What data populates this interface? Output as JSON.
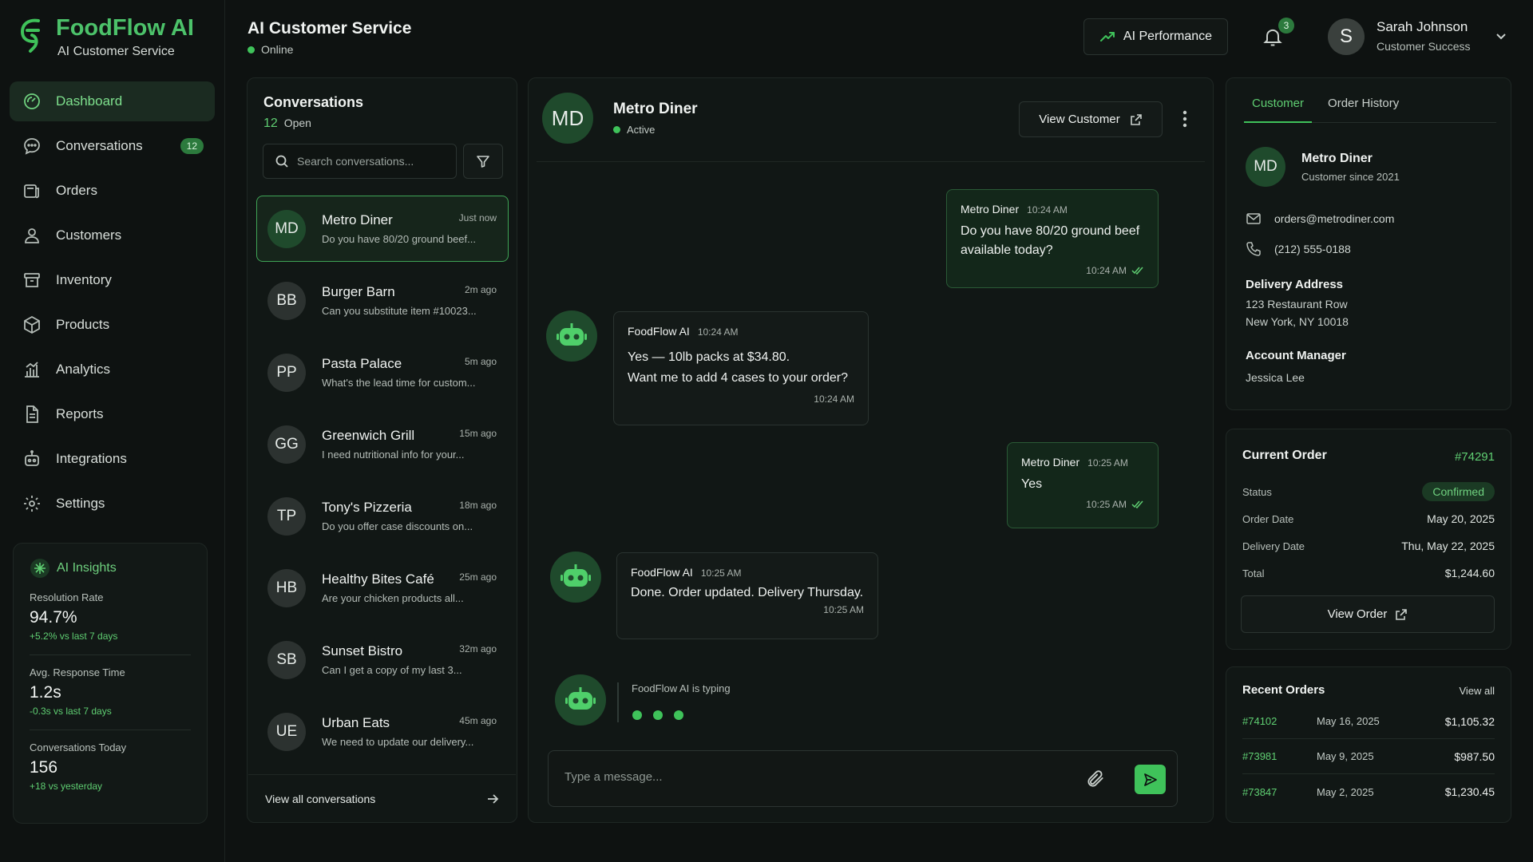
{
  "brand": {
    "title": "FoodFlow AI",
    "subtitle": "AI Customer Service"
  },
  "nav": [
    {
      "label": "Dashboard",
      "icon": "dashboard-icon",
      "active": true
    },
    {
      "label": "Conversations",
      "icon": "chat-icon",
      "badge": "12"
    },
    {
      "label": "Orders",
      "icon": "orders-icon"
    },
    {
      "label": "Customers",
      "icon": "customers-icon"
    },
    {
      "label": "Inventory",
      "icon": "inventory-icon"
    },
    {
      "label": "Products",
      "icon": "products-icon"
    },
    {
      "label": "Analytics",
      "icon": "analytics-icon"
    },
    {
      "label": "Reports",
      "icon": "reports-icon"
    },
    {
      "label": "Integrations",
      "icon": "integrations-icon"
    },
    {
      "label": "Settings",
      "icon": "settings-icon"
    }
  ],
  "insights": {
    "title": "AI Insights",
    "metrics": [
      {
        "label": "Resolution Rate",
        "value": "94.7%",
        "delta": "+5.2% vs last 7 days"
      },
      {
        "label": "Avg. Response Time",
        "value": "1.2s",
        "delta": "-0.3s vs last 7 days"
      },
      {
        "label": "Conversations Today",
        "value": "156",
        "delta": "+18 vs yesterday"
      }
    ]
  },
  "header": {
    "title": "AI Customer Service",
    "status": "Online",
    "perf_label": "AI Performance",
    "notif_count": "3",
    "user": {
      "initial": "S",
      "name": "Sarah Johnson",
      "role": "Customer Success"
    }
  },
  "conversations": {
    "title": "Conversations",
    "open_count": "12",
    "open_label": "Open",
    "search_placeholder": "Search conversations...",
    "items": [
      {
        "initials": "MD",
        "name": "Metro Diner",
        "time": "Just now",
        "preview": "Do you have 80/20 ground beef...",
        "active": true
      },
      {
        "initials": "BB",
        "name": "Burger Barn",
        "time": "2m ago",
        "preview": "Can you substitute item #10023..."
      },
      {
        "initials": "PP",
        "name": "Pasta Palace",
        "time": "5m ago",
        "preview": "What's the lead time for custom..."
      },
      {
        "initials": "GG",
        "name": "Greenwich Grill",
        "time": "15m ago",
        "preview": "I need nutritional info for your..."
      },
      {
        "initials": "TP",
        "name": "Tony's Pizzeria",
        "time": "18m ago",
        "preview": "Do you offer case discounts on..."
      },
      {
        "initials": "HB",
        "name": "Healthy Bites Café",
        "time": "25m ago",
        "preview": "Are your chicken products all..."
      },
      {
        "initials": "SB",
        "name": "Sunset Bistro",
        "time": "32m ago",
        "preview": "Can I get a copy of my last 3..."
      },
      {
        "initials": "UE",
        "name": "Urban Eats",
        "time": "45m ago",
        "preview": "We need to update our delivery..."
      }
    ],
    "view_all": "View all conversations"
  },
  "chat": {
    "initials": "MD",
    "name": "Metro Diner",
    "status": "Active",
    "view_customer": "View Customer",
    "messages": [
      {
        "from": "user",
        "sender": "Metro Diner",
        "time": "10:24 AM",
        "lines": [
          "Do you have 80/20 ground beef",
          "available today?"
        ],
        "foot": "10:24 AM"
      },
      {
        "from": "ai",
        "sender": "FoodFlow AI",
        "time": "10:24 AM",
        "lines": [
          "Yes — 10lb packs at $34.80.",
          "Want me to add 4 cases to your order?"
        ],
        "foot": "10:24 AM"
      },
      {
        "from": "user",
        "sender": "Metro Diner",
        "time": "10:25 AM",
        "lines": [
          "Yes"
        ],
        "foot": "10:25 AM"
      },
      {
        "from": "ai",
        "sender": "FoodFlow AI",
        "time": "10:25 AM",
        "lines": [
          "Done. Order updated. Delivery Thursday."
        ],
        "foot": "10:25 AM"
      }
    ],
    "typing": "FoodFlow AI is typing",
    "composer_placeholder": "Type a message..."
  },
  "customer": {
    "tabs": [
      "Customer",
      "Order History"
    ],
    "initials": "MD",
    "name": "Metro Diner",
    "since": "Customer since 2021",
    "email": "orders@metrodiner.com",
    "phone": "(212) 555-0188",
    "address_label": "Delivery Address",
    "address_line1": "123 Restaurant Row",
    "address_line2": "New York, NY 10018",
    "manager_label": "Account Manager",
    "manager": "Jessica Lee"
  },
  "current_order": {
    "title": "Current Order",
    "number": "#74291",
    "rows": [
      {
        "label": "Status",
        "value": "Confirmed",
        "badge": true
      },
      {
        "label": "Order Date",
        "value": "May 20, 2025"
      },
      {
        "label": "Delivery Date",
        "value": "Thu, May 22, 2025"
      },
      {
        "label": "Total",
        "value": "$1,244.60"
      }
    ],
    "view_label": "View Order"
  },
  "recent_orders": {
    "title": "Recent Orders",
    "view_all": "View all",
    "rows": [
      {
        "id": "#74102",
        "date": "May 16, 2025",
        "amount": "$1,105.32"
      },
      {
        "id": "#73981",
        "date": "May 9, 2025",
        "amount": "$987.50"
      },
      {
        "id": "#73847",
        "date": "May 2, 2025",
        "amount": "$1,230.45"
      }
    ]
  },
  "colors": {
    "accent": "#3fc25a",
    "background": "#0e1211",
    "panel": "#111715"
  }
}
